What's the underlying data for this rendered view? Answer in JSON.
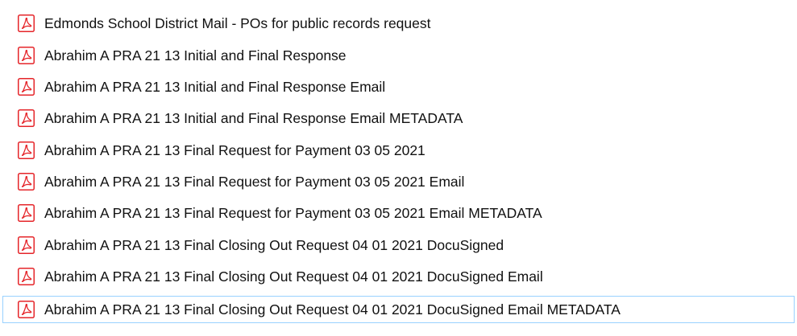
{
  "file_list": {
    "items": [
      {
        "name": "Edmonds School District Mail - POs for public records request",
        "icon": "pdf-file-icon"
      },
      {
        "name": "Abrahim A PRA 21 13 Initial and Final Response",
        "icon": "pdf-file-icon"
      },
      {
        "name": "Abrahim A PRA 21 13 Initial and Final Response Email",
        "icon": "pdf-file-icon"
      },
      {
        "name": "Abrahim A PRA 21 13 Initial and Final Response Email METADATA",
        "icon": "pdf-file-icon"
      },
      {
        "name": "Abrahim A PRA 21 13 Final Request for Payment 03 05 2021",
        "icon": "pdf-file-icon"
      },
      {
        "name": "Abrahim A PRA 21 13 Final Request for Payment 03 05 2021 Email",
        "icon": "pdf-file-icon"
      },
      {
        "name": "Abrahim A PRA 21 13 Final Request for Payment 03 05 2021 Email METADATA",
        "icon": "pdf-file-icon"
      },
      {
        "name": "Abrahim A PRA 21 13 Final Closing Out Request 04 01 2021 DocuSigned",
        "icon": "pdf-file-icon"
      },
      {
        "name": "Abrahim A PRA 21 13 Final Closing Out Request 04 01 2021 DocuSigned Email",
        "icon": "pdf-file-icon"
      },
      {
        "name": "Abrahim A PRA 21 13 Final Closing Out Request 04 01 2021 DocuSigned Email METADATA",
        "icon": "pdf-file-icon"
      }
    ],
    "focused_index": 9,
    "icon_color": "#e5252a",
    "focus_border_color": "#99d1ff"
  }
}
